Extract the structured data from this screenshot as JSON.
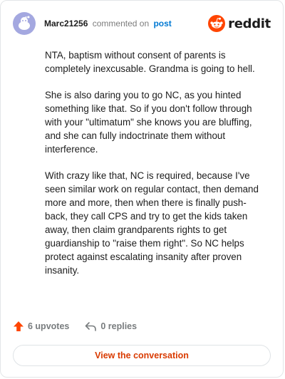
{
  "header": {
    "username": "Marc21256",
    "commented_text": "commented on",
    "post_link": "post",
    "brand": "reddit",
    "colors": {
      "avatar_bg": "#a4a8e0",
      "brand_orange": "#ff4500",
      "link_blue": "#0079d3"
    }
  },
  "comment": {
    "paragraphs": [
      "NTA, baptism without consent of parents is completely inexcusable. Grandma is going to hell.",
      "She is also daring you to go NC, as you hinted something like that. So if you don't follow through with your \"ultimatum\" she knows you are bluffing, and she can fully indoctrinate them without interference.",
      "With crazy like that, NC is required, because I've seen similar work on regular contact, then demand more and more, then when there is finally push-back, they call CPS and try to get the kids taken away, then claim grandparents rights to get guardianship to \"raise them right\". So NC helps protect against escalating insanity after proven insanity."
    ]
  },
  "actions": {
    "upvotes_label": "6 upvotes",
    "replies_label": "0 replies",
    "upvote_icon": "upvote-arrow-icon",
    "reply_icon": "reply-arrow-icon"
  },
  "footer": {
    "view_button_label": "View the conversation",
    "button_text_color": "#d93a00"
  }
}
